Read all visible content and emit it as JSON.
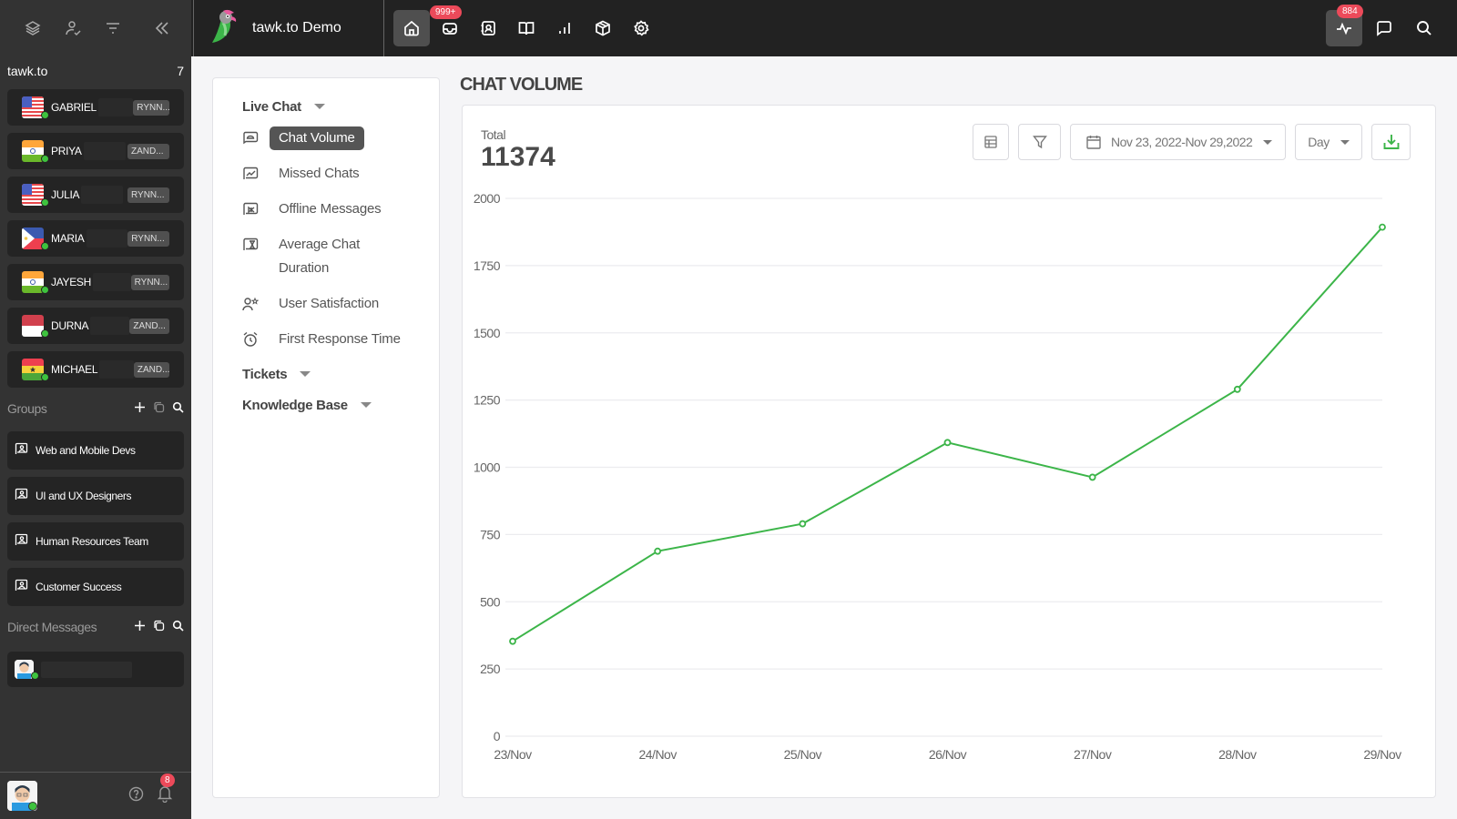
{
  "sidebar": {
    "org_name": "tawk.to",
    "org_count": "7",
    "agents": [
      {
        "name": "GABRIEL",
        "tag": "RYNN...",
        "flag": "us"
      },
      {
        "name": "PRIYA",
        "tag": "ZAND...",
        "flag": "in"
      },
      {
        "name": "JULIA",
        "tag": "RYNN...",
        "flag": "us"
      },
      {
        "name": "MARIA",
        "tag": "RYNN...",
        "flag": "ph"
      },
      {
        "name": "JAYESH",
        "tag": "RYNN...",
        "flag": "in"
      },
      {
        "name": "DURNA",
        "tag": "ZAND...",
        "flag": "id"
      },
      {
        "name": "MICHAEL",
        "tag": "ZAND...",
        "flag": "gh"
      }
    ],
    "groups_label": "Groups",
    "groups": [
      "Web and Mobile Devs",
      "UI and UX Designers",
      "Human Resources Team",
      "Customer Success"
    ],
    "dm_label": "Direct Messages",
    "notifications_count": "8"
  },
  "topbar": {
    "property_name": "tawk.to Demo",
    "inbox_badge": "999+",
    "activity_badge": "884"
  },
  "reports_nav": {
    "categories": [
      {
        "label": "Live Chat",
        "items": [
          "Chat Volume",
          "Missed Chats",
          "Offline Messages",
          "Average Chat Duration",
          "User Satisfaction",
          "First Response Time"
        ]
      },
      {
        "label": "Tickets"
      },
      {
        "label": "Knowledge Base"
      }
    ],
    "active_item": "Chat Volume"
  },
  "main": {
    "title": "CHAT VOLUME",
    "total_label": "Total",
    "total_value": "11374",
    "date_range": "Nov 23, 2022-Nov 29,2022",
    "granularity": "Day",
    "accent_color": "#3cb549"
  },
  "chart_data": {
    "type": "line",
    "title": "",
    "xlabel": "",
    "ylabel": "",
    "categories": [
      "23/Nov",
      "24/Nov",
      "25/Nov",
      "26/Nov",
      "27/Nov",
      "28/Nov",
      "29/Nov"
    ],
    "series": [
      {
        "name": "Chat Volume",
        "values": [
          353,
          688,
          790,
          1092,
          963,
          1290,
          1893
        ],
        "color": "#3cb549"
      }
    ],
    "yticks": [
      "0",
      "250",
      "500",
      "750",
      "1000",
      "1250",
      "1500",
      "1750",
      "2000"
    ],
    "ylim": [
      0,
      2000
    ],
    "grid": true,
    "legend": "none"
  }
}
